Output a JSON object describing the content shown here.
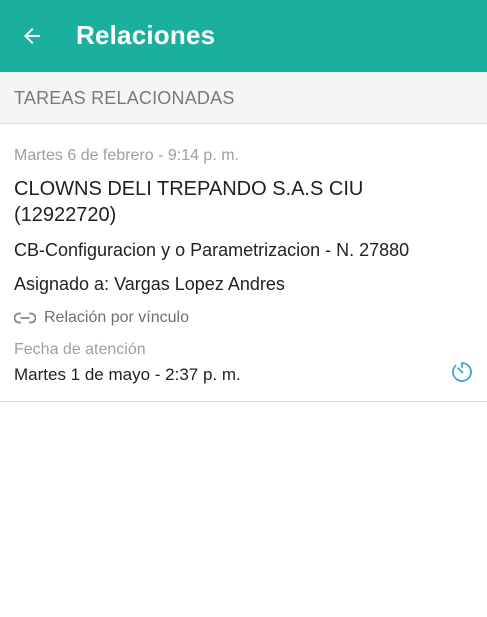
{
  "app_bar": {
    "title": "Relaciones",
    "back_icon": "arrow-left-icon",
    "color": "#1ab09d"
  },
  "section": {
    "title": "TAREAS RELACIONADAS"
  },
  "task": {
    "created": "Martes 6 de febrero - 9:14 p. m.",
    "title": "CLOWNS DELI TREPANDO S.A.S CIU (12922720)",
    "subject": "CB-Configuracion y o Parametrizacion - N. 27880",
    "assignee": "Asignado a: Vargas Lopez Andres",
    "relation_icon": "link-icon",
    "relation": "Relación por vínculo",
    "attention_label": "Fecha de atención",
    "attention_value": "Martes 1 de mayo - 2:37 p. m.",
    "timer_icon": "timer-icon",
    "timer_color": "#3aa6e0"
  }
}
